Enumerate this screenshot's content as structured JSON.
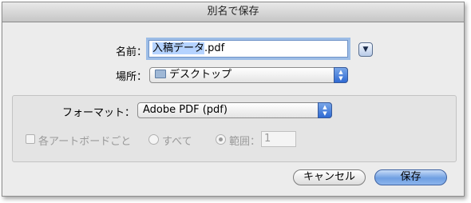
{
  "dialog": {
    "title": "別名で保存",
    "name_label": "名前：",
    "filename_selected": "入稿データ",
    "filename_ext": ".pdf",
    "where_label": "場所：",
    "where_value": "デスクトップ",
    "where_icon": "folder-icon",
    "format_label": "フォーマット：",
    "format_value": "Adobe PDF (pdf)",
    "artboard_checkbox_label": "各アートボードごと",
    "all_label": "すべて",
    "range_label": "範囲：",
    "range_value": "1",
    "cancel_label": "キャンセル",
    "save_label": "保存",
    "accent_color": "#6f9fe2"
  }
}
